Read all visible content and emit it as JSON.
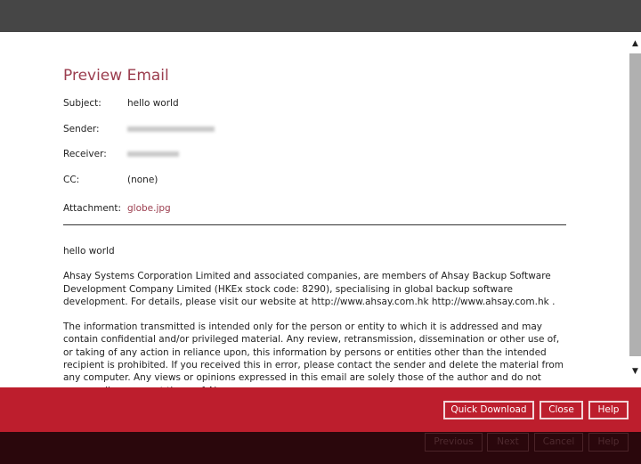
{
  "dialog": {
    "title": "Preview Email",
    "fields": [
      {
        "label": "Subject:",
        "value": "hello world"
      },
      {
        "label": "Sender:"
      },
      {
        "label": "Receiver:"
      },
      {
        "label": "CC:",
        "value": "(none)"
      },
      {
        "label": "Attachment:",
        "value": "globe.jpg"
      }
    ],
    "body": [
      "hello world",
      "Ahsay Systems Corporation Limited and associated companies, are members of Ahsay Backup Software Development Company Limited (HKEx stock code: 8290), specialising in global backup software development.  For details, please visit our website at http://www.ahsay.com.hk http://www.ahsay.com.hk .",
      "The information transmitted is intended only for the person or entity to which it is addressed and may contain confidential and/or privileged material.  Any review, retransmission, dissemination or other use of, or taking of any action in reliance upon, this information by persons or entities other than the intended recipient is prohibited. If you received this in error, please contact the sender and delete the material from any computer. Any views or opinions expressed in this email are solely those of the author and do not necessarily represent those of Ahsay."
    ],
    "buttons": {
      "quick_download": "Quick Download",
      "close": "Close",
      "help": "Help"
    }
  },
  "wizard": {
    "previous": "Previous",
    "next": "Next",
    "cancel": "Cancel",
    "help": "Help"
  },
  "colors": {
    "accent": "#bd1e2d",
    "title": "#9b3d4e"
  }
}
